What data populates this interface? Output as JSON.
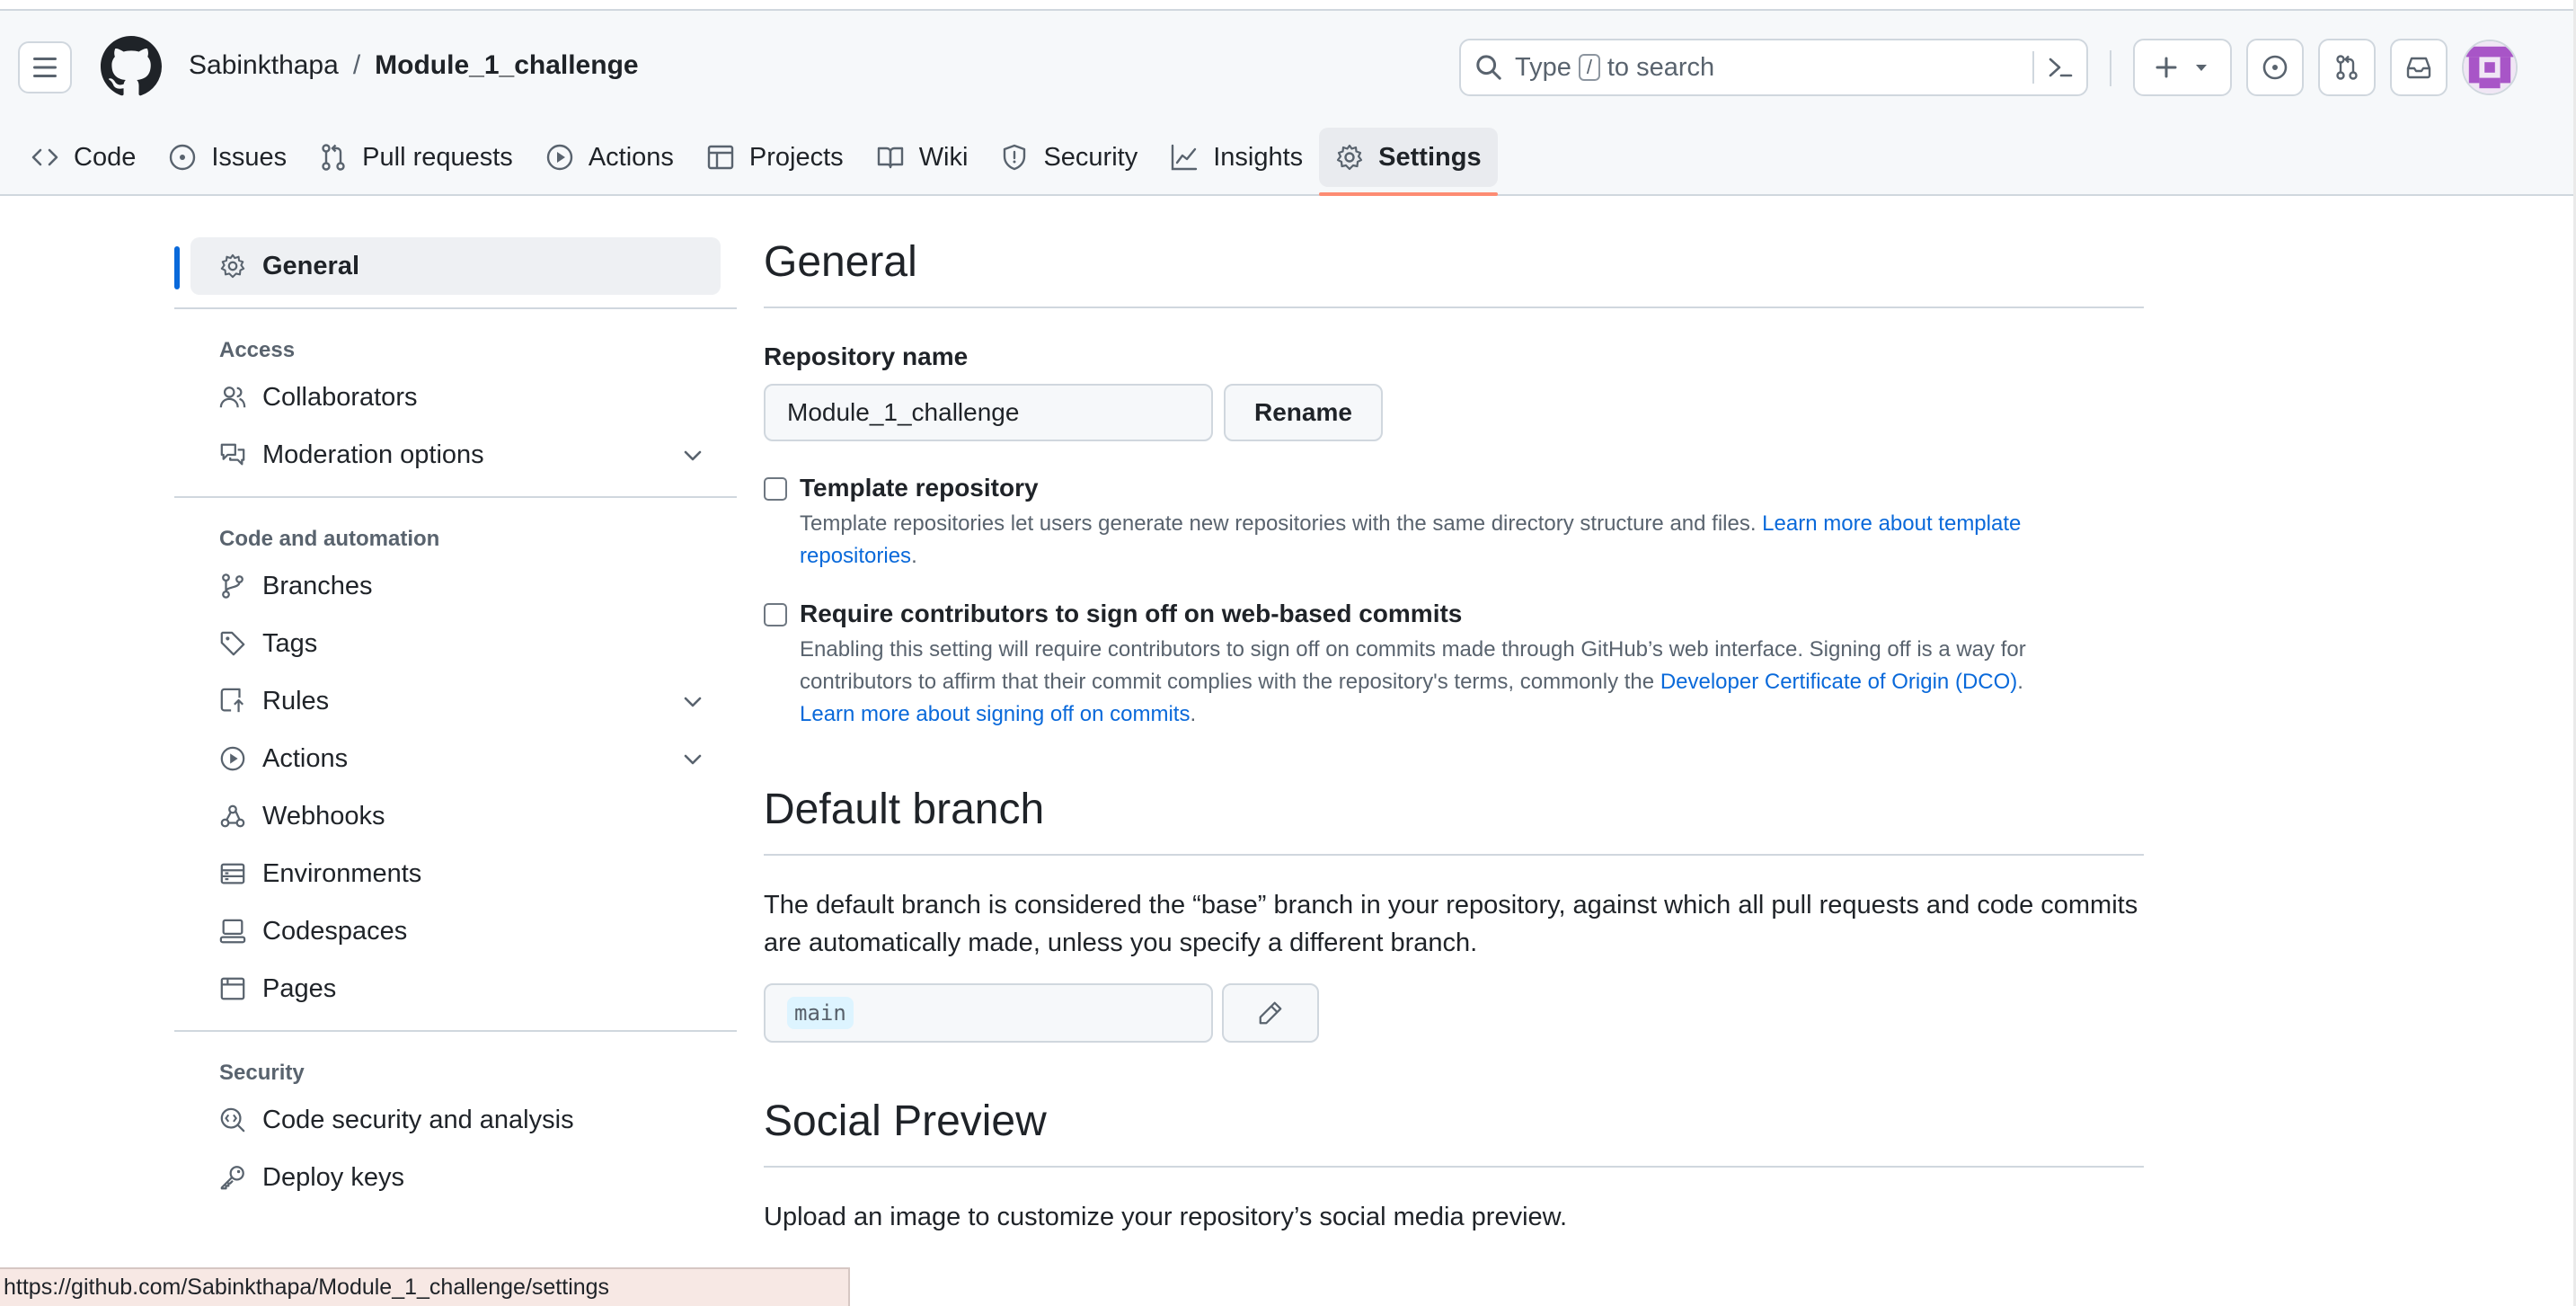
{
  "header": {
    "owner": "Sabinkthapa",
    "separator": "/",
    "repo": "Module_1_challenge",
    "search_prefix": "Type",
    "search_key": "/",
    "search_suffix": "to search"
  },
  "repo_nav": {
    "tabs": [
      {
        "label": "Code",
        "icon": "code-icon"
      },
      {
        "label": "Issues",
        "icon": "issue-icon"
      },
      {
        "label": "Pull requests",
        "icon": "pull-request-icon"
      },
      {
        "label": "Actions",
        "icon": "play-icon"
      },
      {
        "label": "Projects",
        "icon": "table-icon"
      },
      {
        "label": "Wiki",
        "icon": "book-icon"
      },
      {
        "label": "Security",
        "icon": "shield-icon"
      },
      {
        "label": "Insights",
        "icon": "graph-icon"
      },
      {
        "label": "Settings",
        "icon": "gear-icon",
        "selected": true
      }
    ]
  },
  "sidebar": {
    "general": "General",
    "access_heading": "Access",
    "collaborators": "Collaborators",
    "moderation": "Moderation options",
    "code_heading": "Code and automation",
    "branches": "Branches",
    "tags": "Tags",
    "rules": "Rules",
    "actions": "Actions",
    "webhooks": "Webhooks",
    "environments": "Environments",
    "codespaces": "Codespaces",
    "pages": "Pages",
    "security_heading": "Security",
    "code_security": "Code security and analysis",
    "deploy_keys": "Deploy keys"
  },
  "main": {
    "general_title": "General",
    "repo_name_label": "Repository name",
    "repo_name_value": "Module_1_challenge",
    "rename_button": "Rename",
    "template_title": "Template repository",
    "template_desc": "Template repositories let users generate new repositories with the same directory structure and files.",
    "template_link": "Learn more about template repositories",
    "template_after": ".",
    "signoff_title": "Require contributors to sign off on web-based commits",
    "signoff_desc": "Enabling this setting will require contributors to sign off on commits made through GitHub’s web interface. Signing off is a way for contributors to affirm that their commit complies with the repository's terms, commonly the",
    "signoff_link1": "Developer Certificate of Origin (DCO)",
    "signoff_mid": ".",
    "signoff_link2": "Learn more about signing off on commits",
    "signoff_end": ".",
    "default_branch_title": "Default branch",
    "default_branch_desc": "The default branch is considered the “base” branch in your repository, against which all pull requests and code commits are automatically made, unless you specify a different branch.",
    "branch_value": "main",
    "social_title": "Social Preview",
    "social_desc": "Upload an image to customize your repository’s social media preview."
  },
  "status_url": "https://github.com/Sabinkthapa/Module_1_challenge/settings",
  "colors": {
    "accent": "#0969da",
    "tab_underline": "#fd8c73",
    "avatar": "#a855c7"
  }
}
